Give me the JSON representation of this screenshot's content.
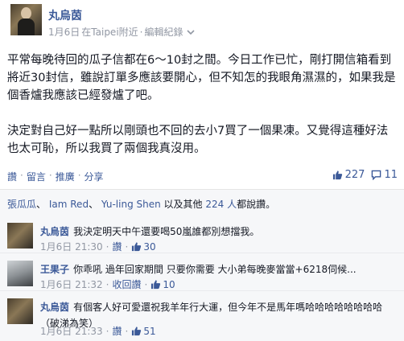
{
  "post": {
    "author": "丸烏茵",
    "date": "1月6日",
    "location": "在Taipei附近",
    "meta_sep": "·",
    "edit_history": "編輯紀錄",
    "paragraphs": [
      "平常每晚待回的瓜子信都在6～10封之間。今日工作已忙，剛打開信箱看到將近30封信，雖說訂單多應該要開心，但不知怎的我眼角濕濕的，如果我是個香爐我應該已經發爐了吧。",
      "決定對自己好一點所以剛頭也不回的去小7買了一個果凍。又覺得這種好法也太可恥，所以我買了兩個我真沒用。"
    ]
  },
  "actions": {
    "like": "讚",
    "comment": "留言",
    "follow": "推廣",
    "share": "分享",
    "sep": "·",
    "like_count": "227",
    "comment_count": "11"
  },
  "likes_summary": {
    "names": [
      "張瓜瓜",
      "Iam Red",
      "Yu-ling Shen"
    ],
    "sep1": "、",
    "sep2": "、",
    "and_others": "以及其他",
    "others_count": "224 人",
    "suffix": "都說讚。"
  },
  "comments": [
    {
      "author": "丸烏茵",
      "text": "我決定明天中午還要喝50嵐誰都別想擋我。",
      "time": "1月6日 21:30",
      "like_label": "讚",
      "like_count": "30"
    },
    {
      "author": "王果子",
      "text": "你乖吼 過年回家期間 只要你需要 大小弟每晚麥當當+6218伺候...",
      "time": "1月6日 21:32",
      "like_label": "收回讚",
      "like_count": "10"
    },
    {
      "author": "丸烏茵",
      "text": "有個客人好可愛還祝我羊年行大運，但今年不是馬年嗎哈哈哈哈哈哈哈哈（破涕為笑）",
      "time": "1月6日 21:33",
      "like_label": "讚",
      "like_count": "51"
    }
  ],
  "colors": {
    "link": "#3b5998",
    "meta": "#9197a3",
    "text": "#141823",
    "panel": "#f6f7f9"
  }
}
